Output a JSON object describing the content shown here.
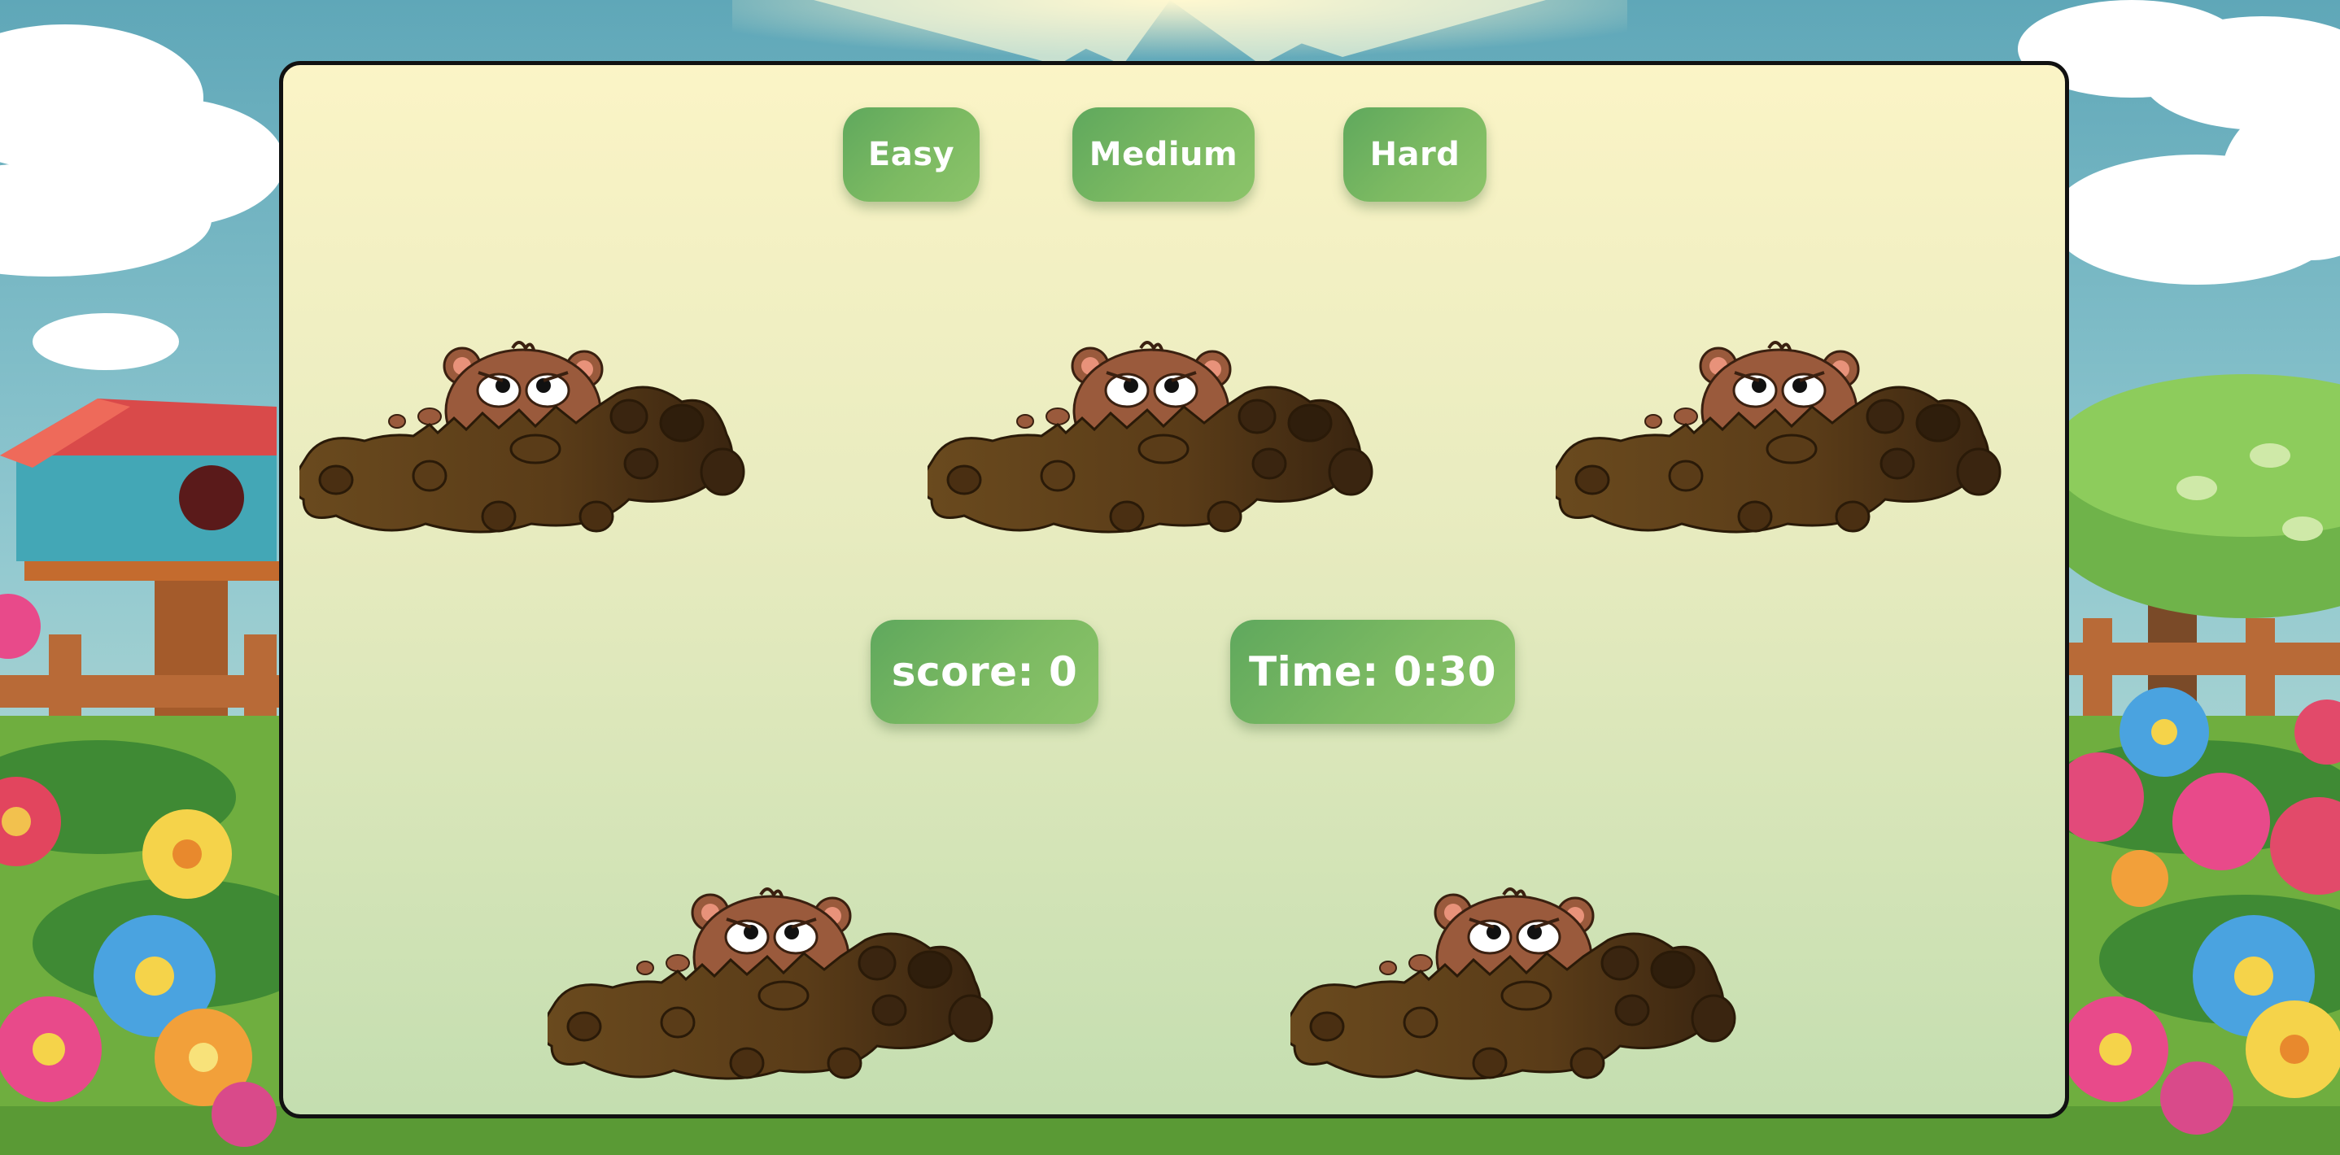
{
  "game": {
    "difficulty": {
      "easy_label": "Easy",
      "medium_label": "Medium",
      "hard_label": "Hard"
    },
    "score_text": "score: 0",
    "time_text": "Time: 0:30",
    "mole_holes": [
      {
        "id": "mole-1"
      },
      {
        "id": "mole-2"
      },
      {
        "id": "mole-3"
      },
      {
        "id": "mole-4"
      },
      {
        "id": "mole-5"
      }
    ]
  },
  "colors": {
    "button_green": "#6cb05f",
    "board_top": "#fbf4c6",
    "board_bottom": "#c4deb0",
    "dirt": "#5a3d1a",
    "mole": "#9a5a3c"
  }
}
